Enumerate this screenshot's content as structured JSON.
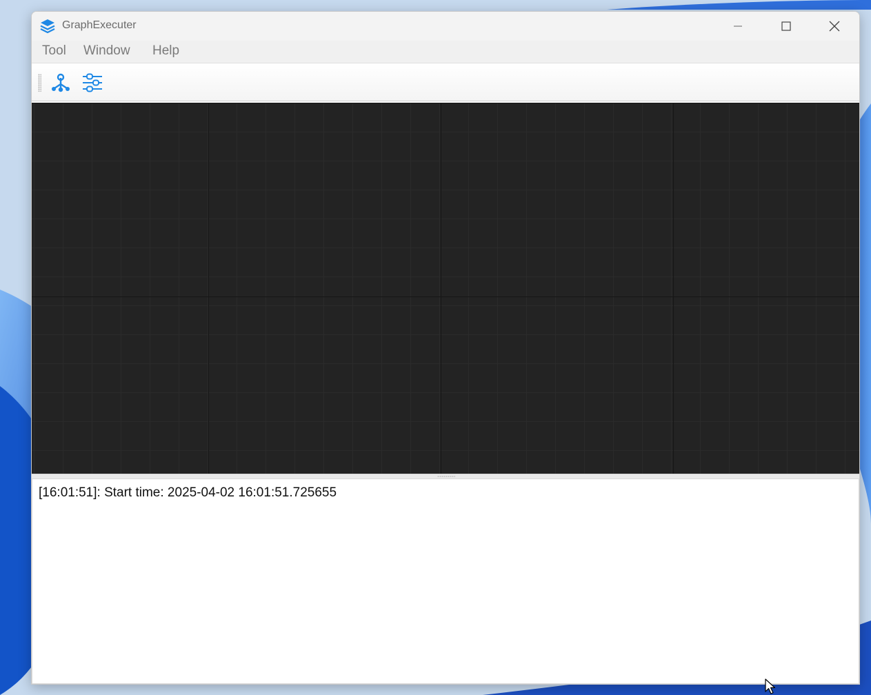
{
  "window": {
    "title": "GraphExecuter"
  },
  "menu": {
    "items": [
      {
        "label": "Tool"
      },
      {
        "label": "Window"
      },
      {
        "label": "Help"
      }
    ]
  },
  "toolbar": {
    "buttons": [
      {
        "icon": "graph-nodes-icon"
      },
      {
        "icon": "sliders-icon"
      }
    ]
  },
  "log": {
    "lines": [
      "[16:01:51]: Start time: 2025-04-02 16:01:51.725655"
    ]
  },
  "colors": {
    "accent": "#1e88e5",
    "canvas_bg": "#232323"
  }
}
